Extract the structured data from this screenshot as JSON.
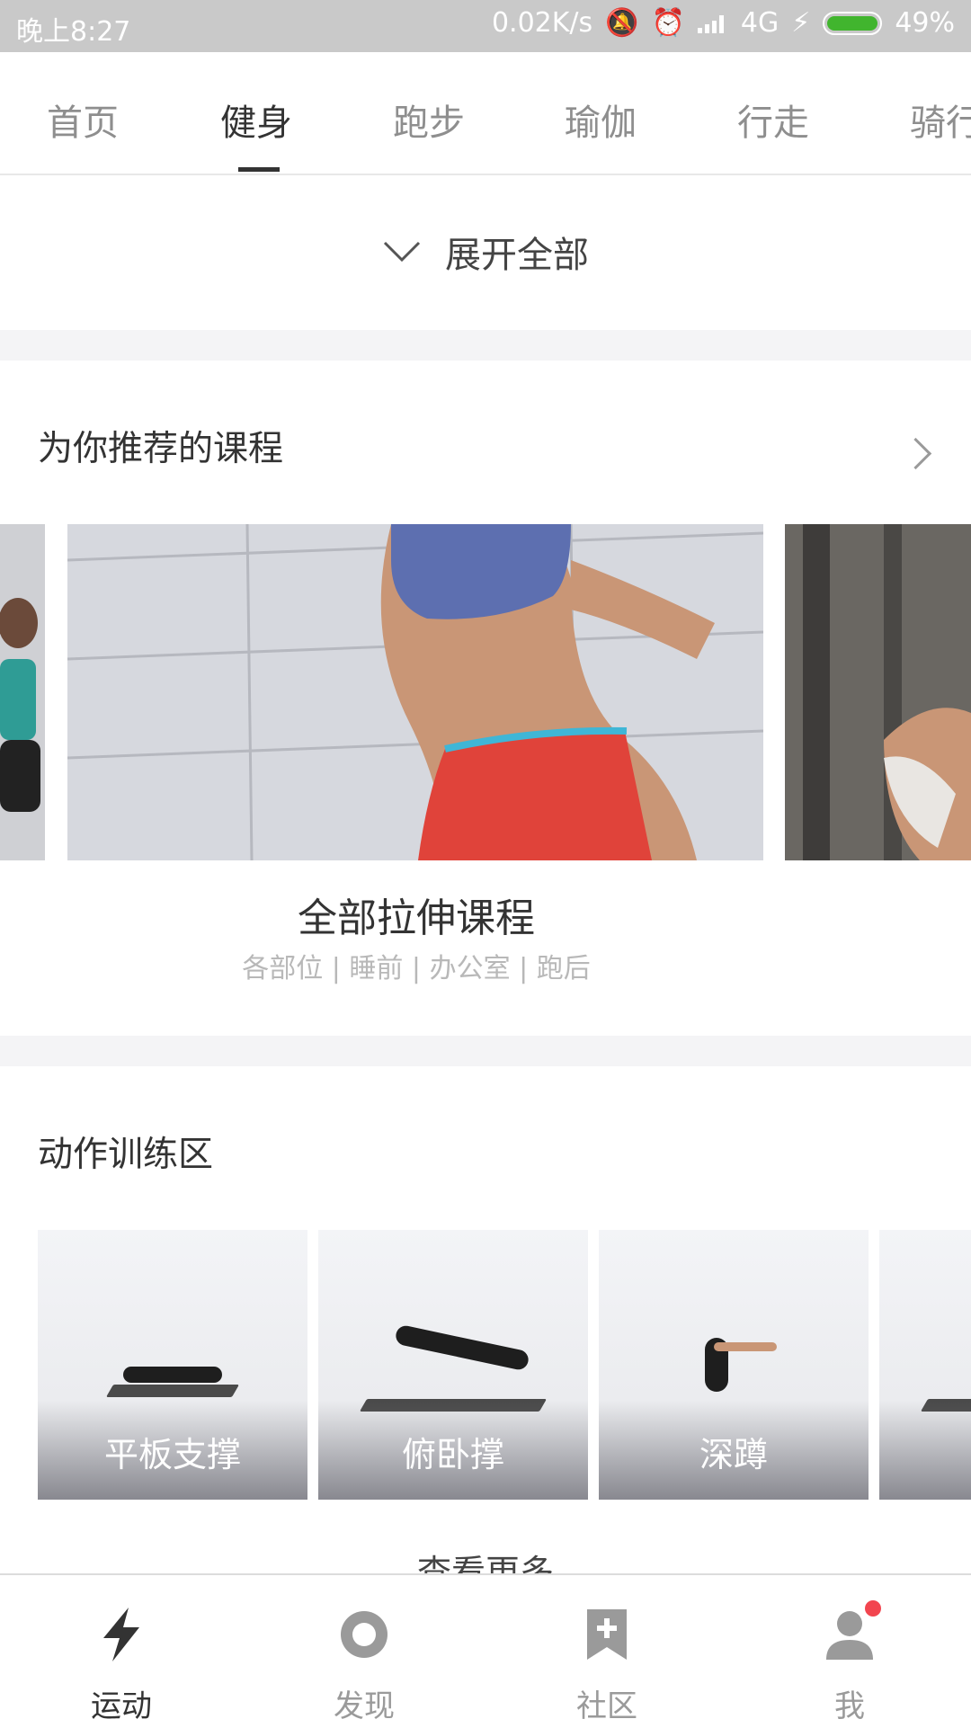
{
  "status_bar": {
    "time": "晚上8:27",
    "net_speed": "0.02K/s",
    "network": "4G",
    "battery": "49%",
    "battery_level": 0.49
  },
  "tabs": [
    {
      "label": "首页",
      "active": false
    },
    {
      "label": "健身",
      "active": true
    },
    {
      "label": "跑步",
      "active": false
    },
    {
      "label": "瑜伽",
      "active": false
    },
    {
      "label": "行走",
      "active": false
    },
    {
      "label": "骑行",
      "active": false
    }
  ],
  "expand_all": {
    "label": "展开全部"
  },
  "recommended": {
    "title": "为你推荐的课程",
    "current_card": {
      "title": "全部拉伸课程",
      "subtitle": "各部位 | 睡前 | 办公室 | 跑后"
    }
  },
  "exercise_area": {
    "title": "动作训练区",
    "items": [
      {
        "label": "平板支撑"
      },
      {
        "label": "俯卧撑"
      },
      {
        "label": "深蹲"
      }
    ],
    "see_more": "查看更多"
  },
  "bottom_nav": [
    {
      "label": "运动",
      "icon": "lightning-icon",
      "active": true
    },
    {
      "label": "发现",
      "icon": "discover-circle-icon",
      "active": false
    },
    {
      "label": "社区",
      "icon": "bookmark-plus-icon",
      "active": false
    },
    {
      "label": "我",
      "icon": "user-icon",
      "active": false,
      "badge": true
    }
  ],
  "colors": {
    "status_bar": "#c9c9c9",
    "active_text": "#333333",
    "inactive_text": "#8e8e8e",
    "badge": "#f2454f",
    "battery": "#41b52e"
  }
}
